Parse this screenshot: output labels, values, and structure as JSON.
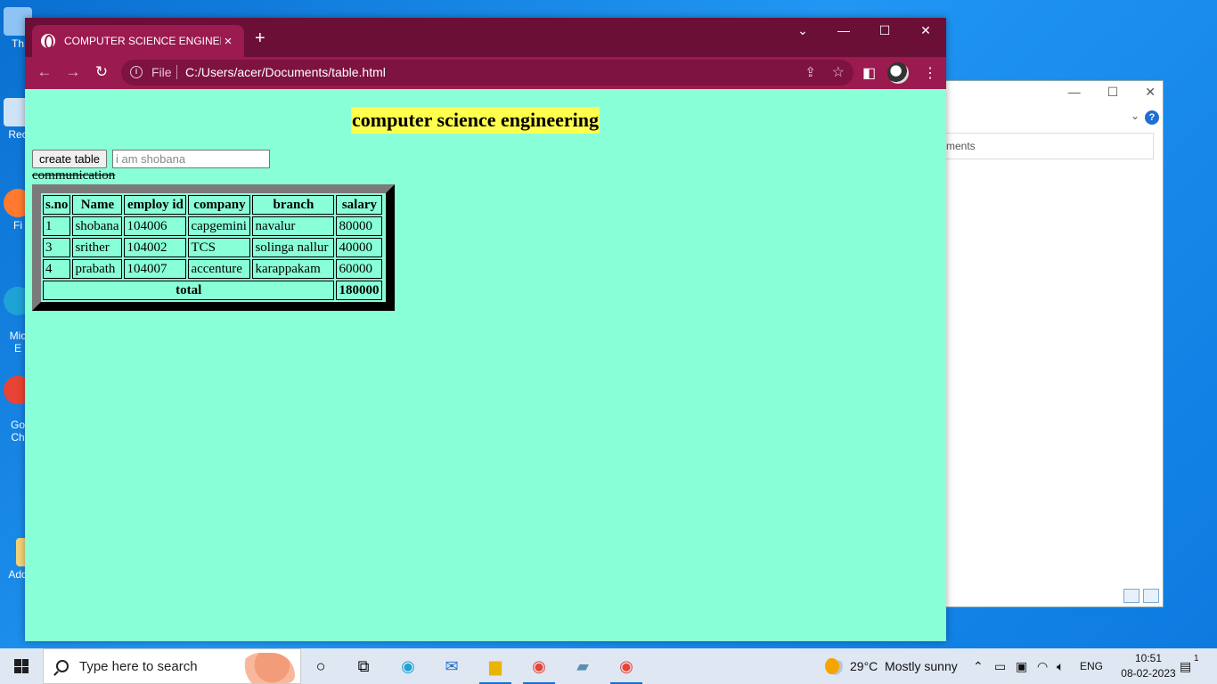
{
  "desktop": {
    "icons": [
      {
        "label": "Th"
      },
      {
        "label": "Rec"
      },
      {
        "label": "Fi"
      },
      {
        "label": "Mic\nE"
      },
      {
        "label": "Go\nCh"
      },
      {
        "label": "Add"
      }
    ]
  },
  "explorer": {
    "address_text": "ments",
    "help_label": "?"
  },
  "browser": {
    "tab_title": "COMPUTER SCIENCE ENGINEERING",
    "tab_close": "×",
    "new_tab": "+",
    "url_scheme": "File",
    "url": "C:/Users/acer/Documents/table.html",
    "window_controls": {
      "dropdown": "⌄",
      "minimize": "—",
      "maximize": "☐",
      "close": "✕"
    }
  },
  "page": {
    "heading": "computer science engineering",
    "create_button": "create table",
    "name_input_value": "i am shobana",
    "strike_text": "communication",
    "table": {
      "headers": [
        "s.no",
        "Name",
        "employ id",
        "company",
        "branch",
        "salary"
      ],
      "rows": [
        [
          "1",
          "shobana",
          "104006",
          "capgemini",
          "navalur",
          "80000"
        ],
        [
          "3",
          "srither",
          "104002",
          "TCS",
          "solinga nallur",
          "40000"
        ],
        [
          "4",
          "prabath",
          "104007",
          "accenture",
          "karappakam",
          "60000"
        ]
      ],
      "total_label": "total",
      "total_value": "180000"
    }
  },
  "taskbar": {
    "search_placeholder": "Type here to search",
    "weather": "29°C  Mostly sunny",
    "language": "ENG",
    "time": "10:51",
    "date": "08-02-2023",
    "notification_count": "1"
  }
}
